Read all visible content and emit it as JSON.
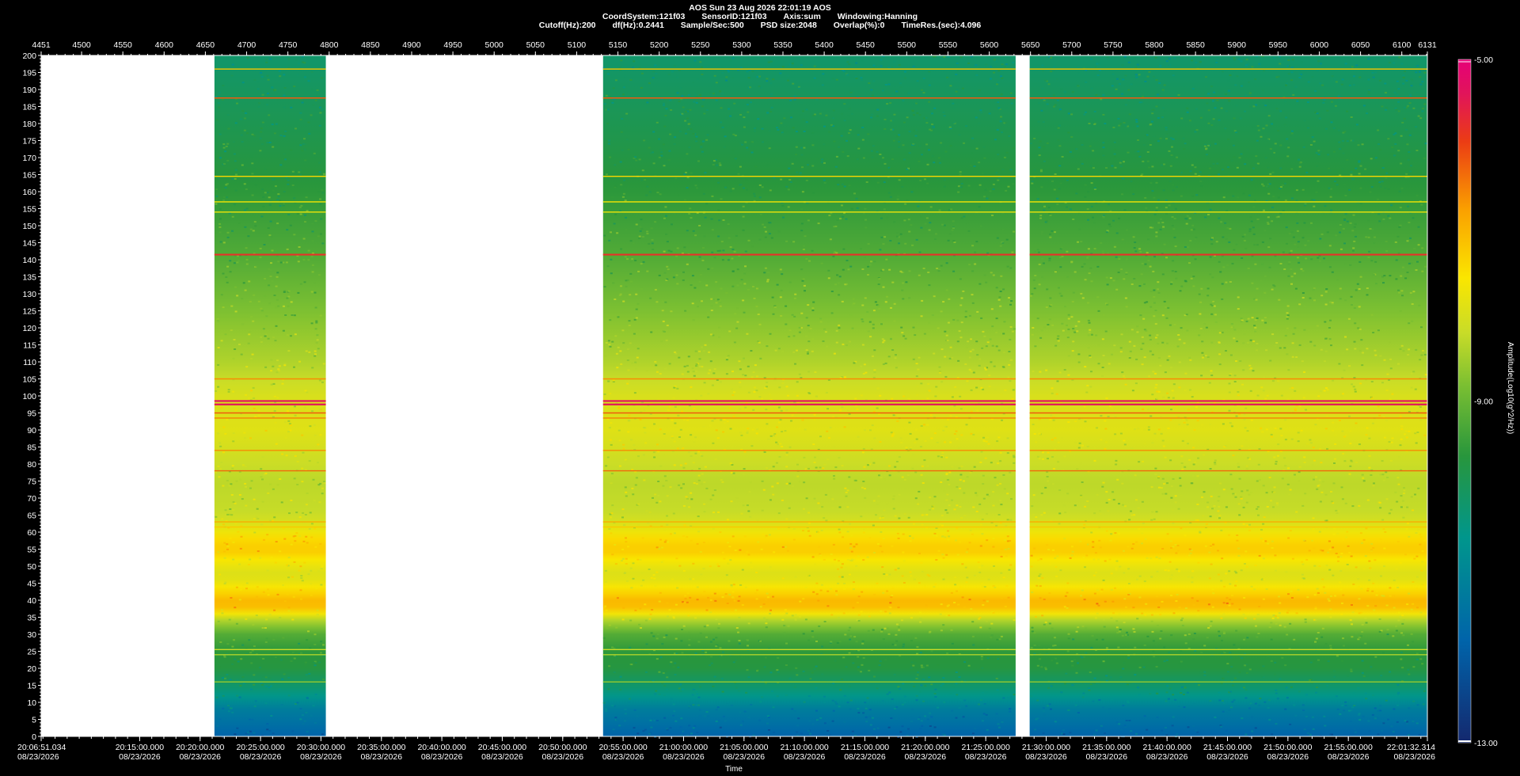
{
  "header": {
    "line1": "AOS  Sun 23 Aug 2026 22:01:19  AOS",
    "line2": [
      "CoordSystem:121f03",
      "SensorID:121f03",
      "Axis:sum",
      "Windowing:Hanning"
    ],
    "line3": [
      "Cutoff(Hz):200",
      "df(Hz):0.2441",
      "Sample/Sec:500",
      "PSD size:2048",
      "Overlap(%):0",
      "TimeRes.(sec):4.096"
    ]
  },
  "chart_data": {
    "type": "heatmap",
    "title": "AOS  Sun 23 Aug 2026 22:01:19  AOS",
    "xlabel": "Time",
    "ylabel": "",
    "colorbar_label": "Amplitude(Log10(g^2/Hz))",
    "colorbar_range": [
      -13.0,
      -5.0
    ],
    "colorbar_ticks": [
      "-5.00",
      "-9.00",
      "-13.00"
    ],
    "ylim": [
      0,
      200
    ],
    "y_ticks": [
      0,
      5,
      10,
      15,
      20,
      25,
      30,
      35,
      40,
      45,
      50,
      55,
      60,
      65,
      70,
      75,
      80,
      85,
      90,
      95,
      100,
      105,
      110,
      115,
      120,
      125,
      130,
      135,
      140,
      145,
      150,
      155,
      160,
      165,
      170,
      175,
      180,
      185,
      190,
      195,
      200
    ],
    "top_axis_range": [
      4451,
      6131
    ],
    "top_axis_ticks": [
      "4451",
      "4500",
      "4550",
      "4600",
      "4650",
      "4700",
      "4750",
      "4800",
      "4850",
      "4900",
      "4950",
      "5000",
      "5050",
      "5100",
      "5150",
      "5200",
      "5250",
      "5300",
      "5350",
      "5400",
      "5450",
      "5500",
      "5550",
      "5600",
      "5650",
      "5700",
      "5750",
      "5800",
      "5850",
      "5900",
      "5950",
      "6000",
      "6050",
      "6100",
      "6131"
    ],
    "time_range": [
      "20:06:51.034",
      "22:01:32.314"
    ],
    "time_ticks": [
      {
        "t": "20:06:51.034",
        "d": "08/23/2026"
      },
      {
        "t": "20:15:00.000",
        "d": "08/23/2026"
      },
      {
        "t": "20:20:00.000",
        "d": "08/23/2026"
      },
      {
        "t": "20:25:00.000",
        "d": "08/23/2026"
      },
      {
        "t": "20:30:00.000",
        "d": "08/23/2026"
      },
      {
        "t": "20:35:00.000",
        "d": "08/23/2026"
      },
      {
        "t": "20:40:00.000",
        "d": "08/23/2026"
      },
      {
        "t": "20:45:00.000",
        "d": "08/23/2026"
      },
      {
        "t": "20:50:00.000",
        "d": "08/23/2026"
      },
      {
        "t": "20:55:00.000",
        "d": "08/23/2026"
      },
      {
        "t": "21:00:00.000",
        "d": "08/23/2026"
      },
      {
        "t": "21:05:00.000",
        "d": "08/23/2026"
      },
      {
        "t": "21:10:00.000",
        "d": "08/23/2026"
      },
      {
        "t": "21:15:00.000",
        "d": "08/23/2026"
      },
      {
        "t": "21:20:00.000",
        "d": "08/23/2026"
      },
      {
        "t": "21:25:00.000",
        "d": "08/23/2026"
      },
      {
        "t": "21:30:00.000",
        "d": "08/23/2026"
      },
      {
        "t": "21:35:00.000",
        "d": "08/23/2026"
      },
      {
        "t": "21:40:00.000",
        "d": "08/23/2026"
      },
      {
        "t": "21:45:00.000",
        "d": "08/23/2026"
      },
      {
        "t": "21:50:00.000",
        "d": "08/23/2026"
      },
      {
        "t": "21:55:00.000",
        "d": "08/23/2026"
      },
      {
        "t": "22:01:32.314",
        "d": "08/23/2026"
      }
    ],
    "data_segments": [
      {
        "start": 4661,
        "end": 4796
      },
      {
        "start": 5132,
        "end": 5632
      },
      {
        "start": 5649,
        "end": 6131
      }
    ],
    "spectral_profile": [
      {
        "hz": 0,
        "v": -11.8
      },
      {
        "hz": 8,
        "v": -11.2
      },
      {
        "hz": 13,
        "v": -10.4
      },
      {
        "hz": 17,
        "v": -10.0
      },
      {
        "hz": 20,
        "v": -9.7
      },
      {
        "hz": 25,
        "v": -9.6
      },
      {
        "hz": 30,
        "v": -9.2
      },
      {
        "hz": 34,
        "v": -8.4
      },
      {
        "hz": 37,
        "v": -7.3
      },
      {
        "hz": 39,
        "v": -6.9
      },
      {
        "hz": 41,
        "v": -7.2
      },
      {
        "hz": 44,
        "v": -7.6
      },
      {
        "hz": 47,
        "v": -8.0
      },
      {
        "hz": 51,
        "v": -7.7
      },
      {
        "hz": 54,
        "v": -7.3
      },
      {
        "hz": 57,
        "v": -7.3
      },
      {
        "hz": 60,
        "v": -7.7
      },
      {
        "hz": 65,
        "v": -8.2
      },
      {
        "hz": 75,
        "v": -8.3
      },
      {
        "hz": 90,
        "v": -7.9
      },
      {
        "hz": 100,
        "v": -8.0
      },
      {
        "hz": 110,
        "v": -8.4
      },
      {
        "hz": 125,
        "v": -8.8
      },
      {
        "hz": 140,
        "v": -9.2
      },
      {
        "hz": 160,
        "v": -9.6
      },
      {
        "hz": 180,
        "v": -9.9
      },
      {
        "hz": 200,
        "v": -10.2
      }
    ],
    "tonal_lines_hz": [
      {
        "hz": 196,
        "v": -7.2
      },
      {
        "hz": 187.5,
        "v": -6.2
      },
      {
        "hz": 164.5,
        "v": -7.4
      },
      {
        "hz": 157,
        "v": -7.6
      },
      {
        "hz": 154,
        "v": -7.7
      },
      {
        "hz": 141.5,
        "v": -5.8
      },
      {
        "hz": 105,
        "v": -6.6
      },
      {
        "hz": 98.5,
        "v": -5.3
      },
      {
        "hz": 97.5,
        "v": -5.4
      },
      {
        "hz": 95,
        "v": -6.2
      },
      {
        "hz": 93.5,
        "v": -6.5
      },
      {
        "hz": 84,
        "v": -6.6
      },
      {
        "hz": 78,
        "v": -6.3
      },
      {
        "hz": 63,
        "v": -6.9
      },
      {
        "hz": 61.5,
        "v": -7.2
      },
      {
        "hz": 25.5,
        "v": -8.2
      },
      {
        "hz": 24,
        "v": -8.4
      },
      {
        "hz": 16,
        "v": -8.6
      }
    ],
    "grid": false
  }
}
